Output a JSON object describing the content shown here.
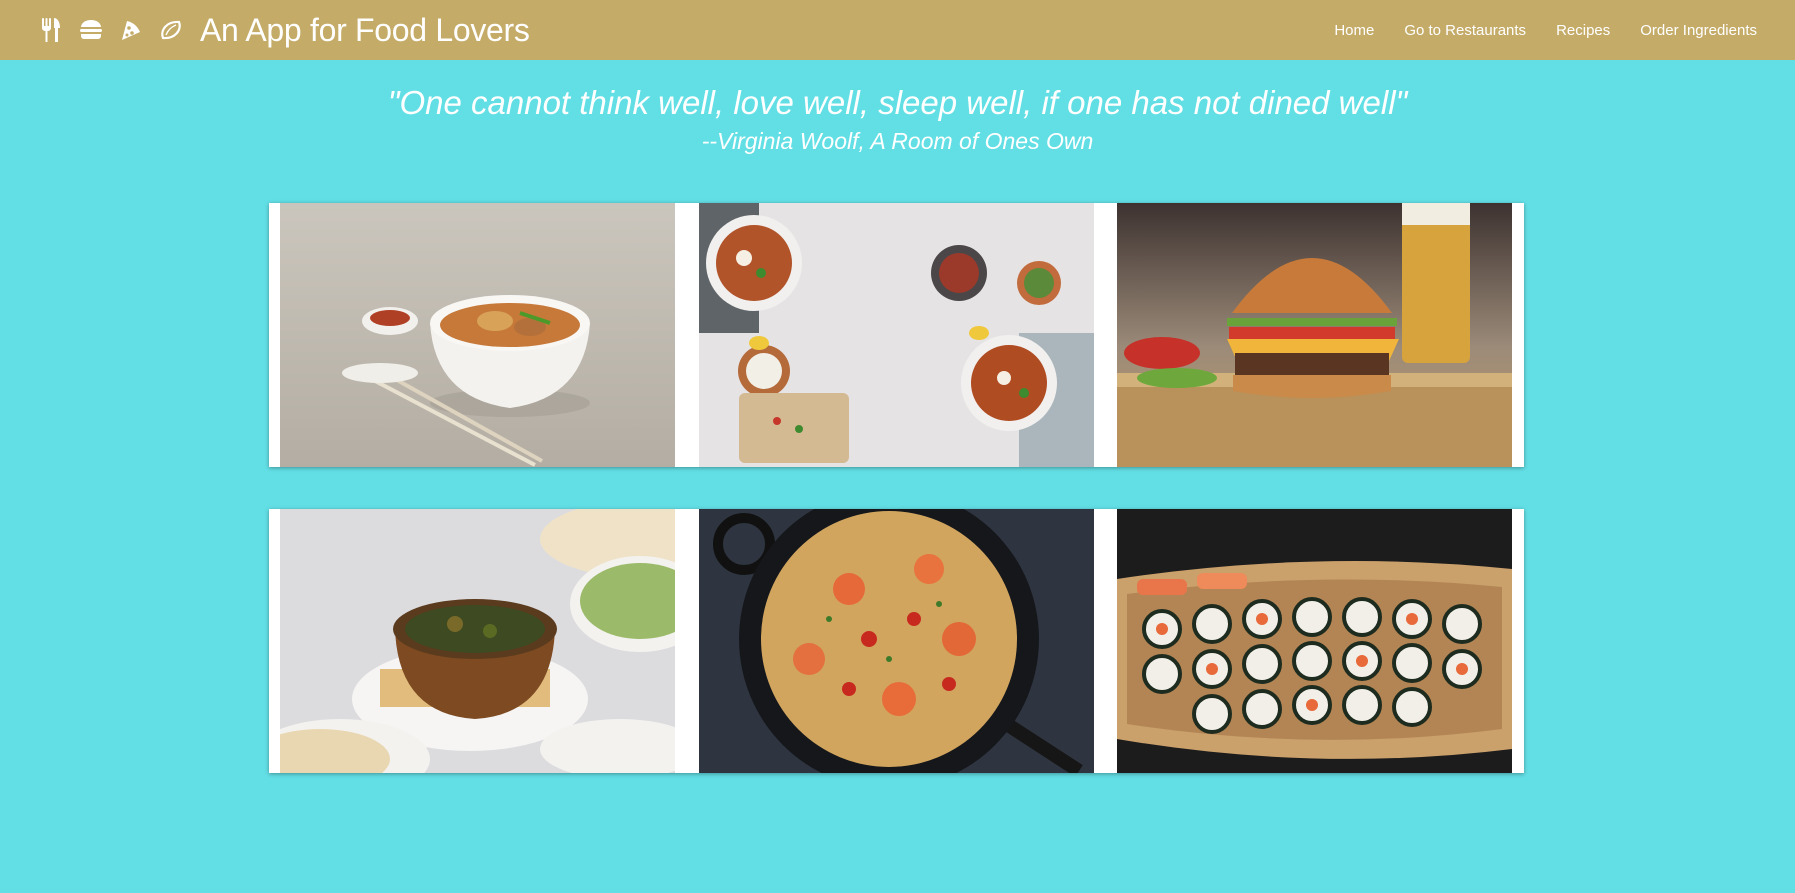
{
  "nav": {
    "brand_icons": [
      "utensils-icon",
      "hamburger-icon",
      "pizza-slice-icon",
      "lemon-icon"
    ],
    "title": "An App for Food Lovers",
    "links": [
      "Home",
      "Go to Restaurants",
      "Recipes",
      "Order Ingredients"
    ]
  },
  "quote": {
    "text": "\"One cannot think well, love well, sleep well, if one has not dined well\"",
    "attribution": "--Virginia Woolf, A Room of Ones Own"
  },
  "gallery": {
    "images": [
      "noodle-soup-photo",
      "sweet-potato-fries-photo",
      "cheeseburger-photo",
      "curry-with-naan-photo",
      "shrimp-spaghetti-photo",
      "sushi-boat-photo"
    ]
  },
  "colors": {
    "navbar": "#c5ab68",
    "background": "#62dfe5",
    "text": "#ffffff"
  }
}
